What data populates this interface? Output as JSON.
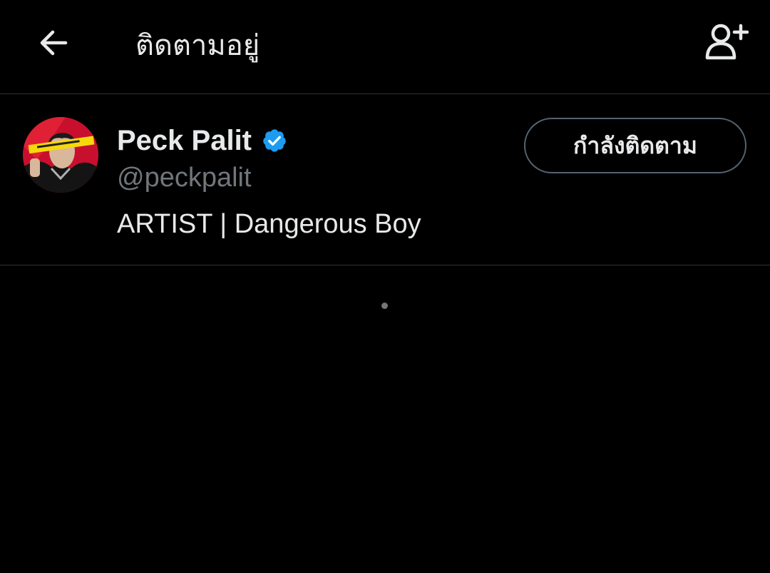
{
  "header": {
    "title": "ติดตามอยู่",
    "back_icon": "arrow-left-icon",
    "add_icon": "person-plus-icon"
  },
  "user": {
    "display_name": "Peck Palit",
    "handle": "@peckpalit",
    "bio": "ARTIST | Dangerous Boy",
    "verified": true,
    "follow_button_label": "กำลังติดตาม"
  },
  "colors": {
    "background": "#000000",
    "text_primary": "#e7e9ea",
    "text_secondary": "#71767b",
    "divider": "#2f3336",
    "verified_blue": "#1d9bf0",
    "button_border": "#536471"
  }
}
